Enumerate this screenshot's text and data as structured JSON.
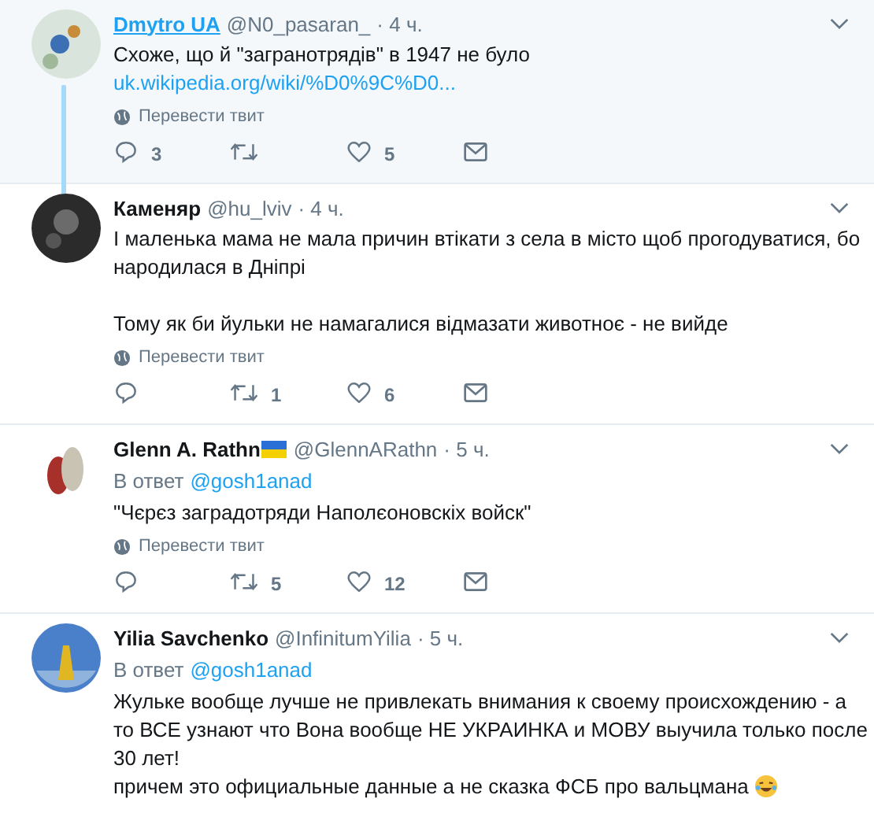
{
  "tweets": [
    {
      "name": "Dmytro UA",
      "handle": "@N0_pasaran_",
      "time": "· 4 ч.",
      "hovered": true,
      "flag": false,
      "thread_line": true,
      "paragraph_gap": false,
      "paragraphs": [
        "Схоже, що й \"загранотрядів\" в 1947 не було"
      ],
      "link": "uk.wikipedia.org/wiki/%D0%9C%D0...",
      "emoji": false,
      "translate": "Перевести твит",
      "replies": "3",
      "likes": "5"
    },
    {
      "name": "Каменяр",
      "handle": "@hu_lviv",
      "time": "· 4 ч.",
      "hovered": false,
      "flag": false,
      "thread_line": false,
      "paragraph_gap": true,
      "paragraphs": [
        "І маленька мама не мала причин втікати з села в місто щоб прогодуватися, бо народилася в Дніпрі",
        "Тому як би йульки не намагалися відмазати животноє - не вийде"
      ],
      "emoji": false,
      "translate": "Перевести твит",
      "retweets": "1",
      "likes": "6"
    },
    {
      "name": "Glenn A. Rathn",
      "handle": "@GlennARathn",
      "time": "· 5 ч.",
      "hovered": false,
      "flag": true,
      "thread_line": false,
      "reply_label": "В ответ",
      "reply_to": "@gosh1anad",
      "paragraph_gap": false,
      "paragraphs": [
        "\"Чєрєз заградотряди Наполєоновскіх войск\""
      ],
      "emoji": false,
      "translate": "Перевести твит",
      "retweets": "5",
      "likes": "12"
    },
    {
      "name": "Yilia Savchenko",
      "handle": "@InfinitumYilia",
      "time": "· 5 ч.",
      "hovered": false,
      "flag": false,
      "thread_line": false,
      "reply_label": "В ответ",
      "reply_to": "@gosh1anad",
      "paragraph_gap": false,
      "paragraphs": [
        "Жульке вообще лучше не привлекать внимания к своему происхождению - а то ВСЕ узнают что Вона вообще НЕ УКРАИНКА и МОВУ выучила только после 30 лет!",
        "причем это официальные данные а не сказка ФСБ про вальцмана"
      ],
      "emoji": true
    }
  ]
}
